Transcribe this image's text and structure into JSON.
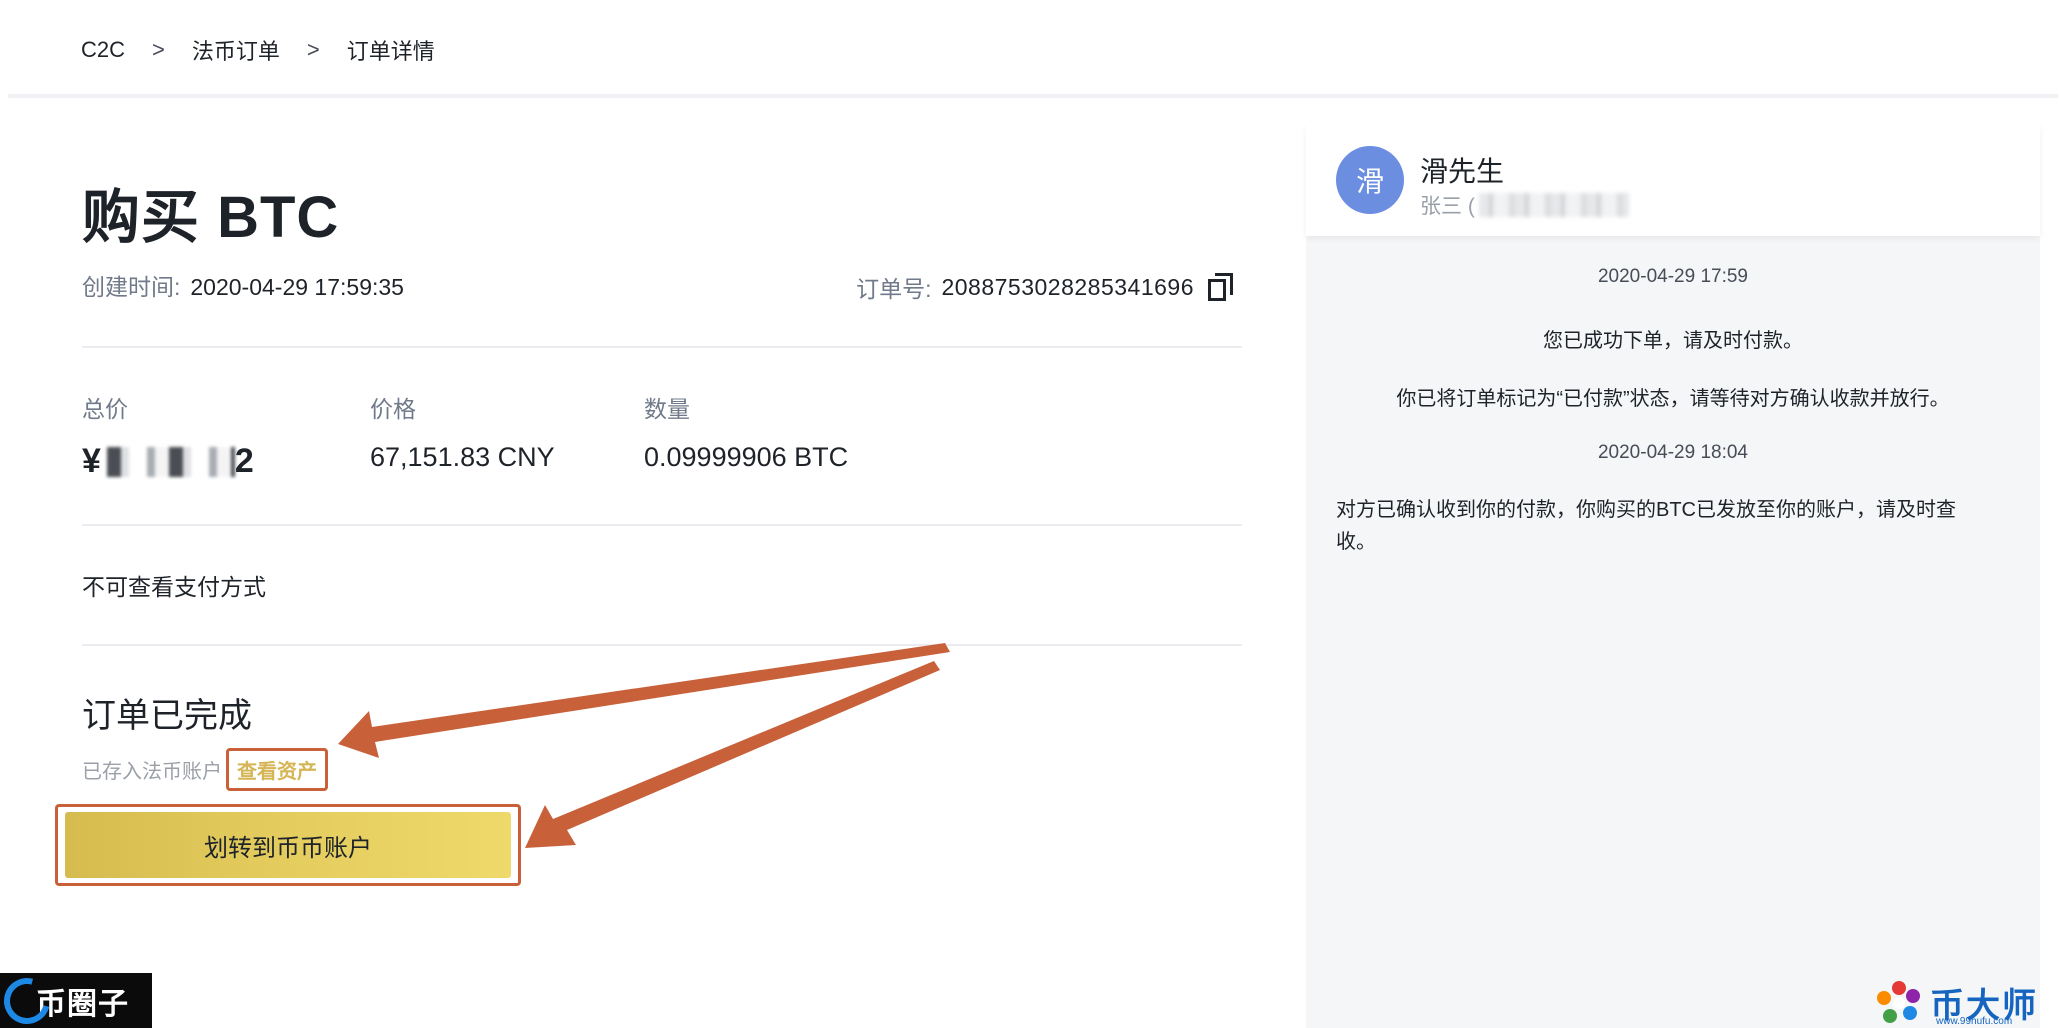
{
  "breadcrumb": {
    "items": [
      "C2C",
      "法币订单",
      "订单详情"
    ],
    "separator": ">"
  },
  "order": {
    "title": "购买 BTC",
    "created_label": "创建时间:",
    "created_value": "2020-04-29 17:59:35",
    "order_no_label": "订单号:",
    "order_no_value": "2088753028285341696",
    "total_label": "总价",
    "total_value_visible_start": "¥",
    "total_value_visible_end": "2",
    "price_label": "价格",
    "price_value": "67,151.83 CNY",
    "qty_label": "数量",
    "qty_value": "0.09999906 BTC",
    "payment_method_text": "不可查看支付方式",
    "status_title": "订单已完成",
    "status_sub": "已存入法币账户",
    "view_assets_label": "查看资产",
    "transfer_button_label": "划转到币币账户"
  },
  "chat": {
    "avatar_char": "滑",
    "name": "滑先生",
    "sub_visible": "张三 (",
    "messages": [
      {
        "type": "timestamp",
        "text": "2020-04-29 17:59"
      },
      {
        "type": "system",
        "text": "您已成功下单，请及时付款。"
      },
      {
        "type": "system",
        "text": "你已将订单标记为“已付款”状态，请等待对方确认收款并放行。"
      },
      {
        "type": "timestamp",
        "text": "2020-04-29 18:04"
      },
      {
        "type": "system",
        "text": "对方已确认收到你的付款，你购买的BTC已发放至你的账户，请及时查收。"
      }
    ]
  },
  "watermarks": {
    "left_text": "币圈子",
    "right_brand": "币大师",
    "right_url": "www.99hufu.com"
  },
  "colors": {
    "accent_gold": "#e4cd5e",
    "annotation_orange": "#c8613a",
    "avatar_blue": "#6b8ee0",
    "link_gold": "#d5b556"
  }
}
